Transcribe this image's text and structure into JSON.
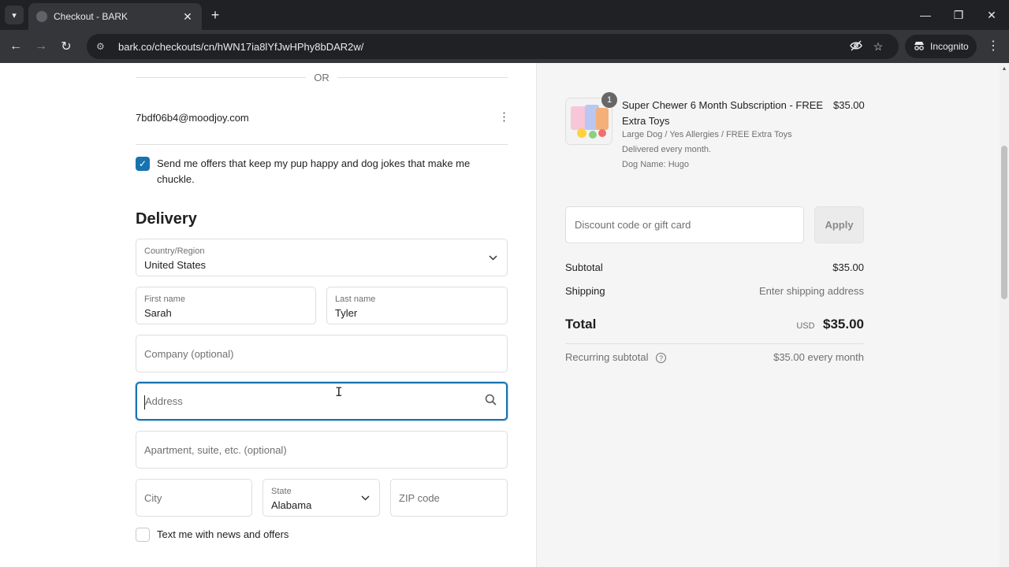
{
  "browser": {
    "tab_title": "Checkout - BARK",
    "url": "bark.co/checkouts/cn/hWN17ia8lYfJwHPhy8bDAR2w/",
    "incognito_label": "Incognito"
  },
  "contact": {
    "or_label": "OR",
    "email": "7bdf06b4@moodjoy.com",
    "marketing_checked": true,
    "marketing_label": "Send me offers that keep my pup happy and dog jokes that make me chuckle."
  },
  "delivery": {
    "title": "Delivery",
    "country_label": "Country/Region",
    "country_value": "United States",
    "first_name_label": "First name",
    "first_name_value": "Sarah",
    "last_name_label": "Last name",
    "last_name_value": "Tyler",
    "company_placeholder": "Company (optional)",
    "address_placeholder": "Address",
    "apartment_placeholder": "Apartment, suite, etc. (optional)",
    "city_placeholder": "City",
    "state_label": "State",
    "state_value": "Alabama",
    "zip_placeholder": "ZIP code",
    "sms_checked": false,
    "sms_label": "Text me with news and offers"
  },
  "order": {
    "item": {
      "quantity": "1",
      "name": "Super Chewer 6 Month Subscription - FREE Extra Toys",
      "price": "$35.00",
      "variant": "Large Dog / Yes Allergies / FREE Extra Toys",
      "delivery": "Delivered every month.",
      "dog_name": "Dog Name: Hugo"
    },
    "discount_placeholder": "Discount code or gift card",
    "apply_label": "Apply",
    "subtotal_label": "Subtotal",
    "subtotal_value": "$35.00",
    "shipping_label": "Shipping",
    "shipping_value": "Enter shipping address",
    "total_label": "Total",
    "total_currency": "USD",
    "total_value": "$35.00",
    "recurring_label": "Recurring subtotal",
    "recurring_value": "$35.00 every month"
  },
  "colors": {
    "accent": "#1773b0",
    "summary_bg": "#f5f5f5",
    "chrome_dark": "#202124"
  },
  "icons": [
    "tab-list-icon",
    "favicon-icon",
    "close-icon",
    "plus-icon",
    "minimize-icon",
    "restore-icon",
    "window-close-icon",
    "back-icon",
    "forward-icon",
    "reload-icon",
    "site-info-icon",
    "eye-off-icon",
    "star-icon",
    "incognito-icon",
    "more-icon",
    "kebab-icon",
    "check-icon",
    "chevron-down-icon",
    "search-icon",
    "help-icon",
    "text-cursor-icon"
  ]
}
